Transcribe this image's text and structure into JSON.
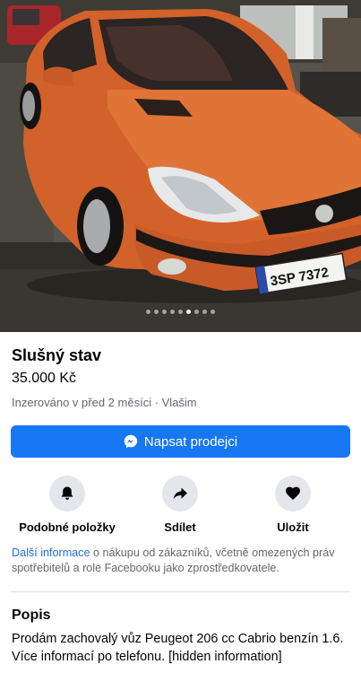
{
  "photo": {
    "alt": "Orange Peugeot 206 CC",
    "plate": "3SP 7372",
    "image_count": 9,
    "active_index": 5
  },
  "listing": {
    "title": "Slušný stav",
    "price": "35.000 Kč",
    "meta": "Inzerováno v před 2 měsíci · Vlašim"
  },
  "message_button": {
    "label": "Napsat prodejci",
    "icon": "messenger-icon"
  },
  "actions": [
    {
      "label": "Podobné položky",
      "icon": "bell-icon"
    },
    {
      "label": "Sdílet",
      "icon": "share-icon"
    },
    {
      "label": "Uložit",
      "icon": "heart-icon"
    }
  ],
  "info": {
    "link": "Další informace",
    "text": " o nákupu od zákazníků, včetně omezených práv spotřebitelů a role Facebooku jako zprostředkovatele."
  },
  "description": {
    "heading": "Popis",
    "text": "Prodám zachovalý vůz Peugeot 206 cc  Cabrio benzín 1.6. Více informací po telefonu. [hidden information]"
  },
  "colors": {
    "accent": "#1877f2",
    "car": "#d2612a",
    "secondary_text": "#65676b",
    "circle_bg": "#e4e6eb"
  }
}
